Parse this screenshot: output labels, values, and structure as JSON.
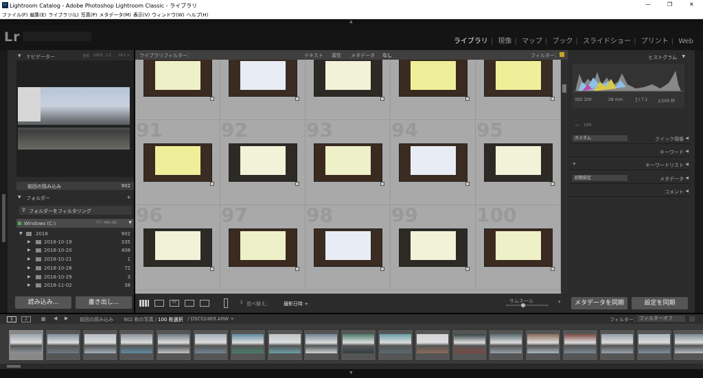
{
  "window": {
    "title": "Lightroom Catalog - Adobe Photoshop Lightroom Classic - ライブラリ",
    "icon": "Lr",
    "minimize": "—",
    "maximize": "❐",
    "close": "✕"
  },
  "menu": [
    "ファイル(F)",
    "編集(E)",
    "ライブラリ(L)",
    "写真(P)",
    "メタデータ(M)",
    "表示(V)",
    "ウィンドウ(W)",
    "ヘルプ(H)"
  ],
  "identity": {
    "logo": "Lr"
  },
  "modules": [
    {
      "label": "ライブラリ",
      "active": true
    },
    {
      "label": "現像",
      "active": false
    },
    {
      "label": "マップ",
      "active": false
    },
    {
      "label": "ブック",
      "active": false
    },
    {
      "label": "スライドショー",
      "active": false
    },
    {
      "label": "プリント",
      "active": false
    },
    {
      "label": "Web",
      "active": false
    }
  ],
  "left": {
    "navigator": {
      "title": "ナビゲーター",
      "zoom": [
        "全体",
        "100%",
        "1:1",
        "24:1 ÷"
      ]
    },
    "catalog_row": {
      "label": "前回の読み込み",
      "count": "902"
    },
    "folders": {
      "title": "フォルダー",
      "plus": "+"
    },
    "folder_filter": "フォルダーをフィルタリング",
    "volume": {
      "name": "Windows (C:)",
      "space": "77 / 466 GB"
    },
    "tree": [
      {
        "name": "2018",
        "count": "902",
        "arrow": "▼"
      },
      {
        "name": "2018-10-19",
        "count": "335",
        "arrow": "▶"
      },
      {
        "name": "2018-10-20",
        "count": "408",
        "arrow": "▶"
      },
      {
        "name": "2018-10-21",
        "count": "1",
        "arrow": "▶"
      },
      {
        "name": "2018-10-28",
        "count": "72",
        "arrow": "▶"
      },
      {
        "name": "2018-10-29",
        "count": "3",
        "arrow": "▶"
      },
      {
        "name": "2018-11-02",
        "count": "38",
        "arrow": "▶"
      }
    ],
    "import_label": "読み込み...",
    "export_label": "書き出し..."
  },
  "filterbar": {
    "label": "ライブラリフィルター：",
    "tabs": [
      "テキスト",
      "属性",
      "メタデータ",
      "なし"
    ],
    "right": "フィルター："
  },
  "grid": {
    "rows": [
      {
        "numbers": [
          "",
          "",
          "",
          "",
          ""
        ]
      },
      {
        "numbers": [
          "91",
          "92",
          "93",
          "94",
          "95"
        ]
      },
      {
        "numbers": [
          "96",
          "97",
          "98",
          "99",
          "100"
        ]
      }
    ]
  },
  "toolbar": {
    "sort_label": "並べ替え：",
    "sort_value": "撮影日時 ÷",
    "thumb_label": "サムネール"
  },
  "right": {
    "histogram_title": "ヒストグラム",
    "iso": "ISO 100",
    "focal": "28 mm",
    "aperture": "ƒ / 7.1",
    "shutter": "1/100 秒",
    "original_label": "100",
    "quick_label": "クイック現像",
    "quick_value": "カスタム",
    "keyword_label": "キーワード",
    "keywordlist_label": "キーワードリスト",
    "metadata_label": "メタデータ",
    "metadata_value": "初期設定",
    "comments_label": "コメント",
    "sync_meta": "メタデータを同期",
    "sync_settings": "設定を同期"
  },
  "filmstrip": {
    "page1": "1",
    "page2": "2",
    "source": "前回の読み込み",
    "info": "902 枚の写真 /",
    "selected": "100 枚選択",
    "file": "/ DSC02469.ARW ÷",
    "filter_label": "フィルター：",
    "filter_value": "フィルターオフ"
  }
}
